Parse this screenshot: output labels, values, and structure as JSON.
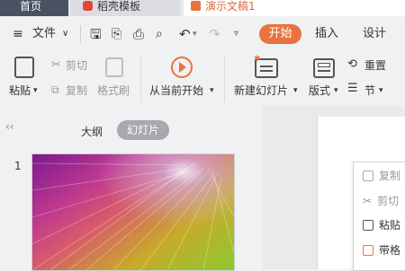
{
  "tabs": [
    {
      "label": "首页"
    },
    {
      "label": "稻壳模板"
    },
    {
      "label": "演示文稿1"
    }
  ],
  "toolbar": {
    "file_label": "文件",
    "start_tab": "开始",
    "insert_tab": "插入",
    "design_tab": "设计"
  },
  "ribbon": {
    "paste": "粘贴",
    "cut": "剪切",
    "copy": "复制",
    "format_painter": "格式刷",
    "play_from_current": "从当前开始",
    "new_slide": "新建幻灯片",
    "layout": "版式",
    "reset": "重置",
    "section": "节"
  },
  "panel": {
    "outline_tab": "大纲",
    "slides_tab": "幻灯片",
    "slide_number": "1"
  },
  "context_menu": {
    "items": [
      "复制",
      "剪切",
      "粘贴",
      "带格"
    ]
  },
  "colors": {
    "accent": "#e8733f",
    "home_tab_bg": "#4a5160",
    "slides_tab_bg": "#a7a9ad"
  }
}
